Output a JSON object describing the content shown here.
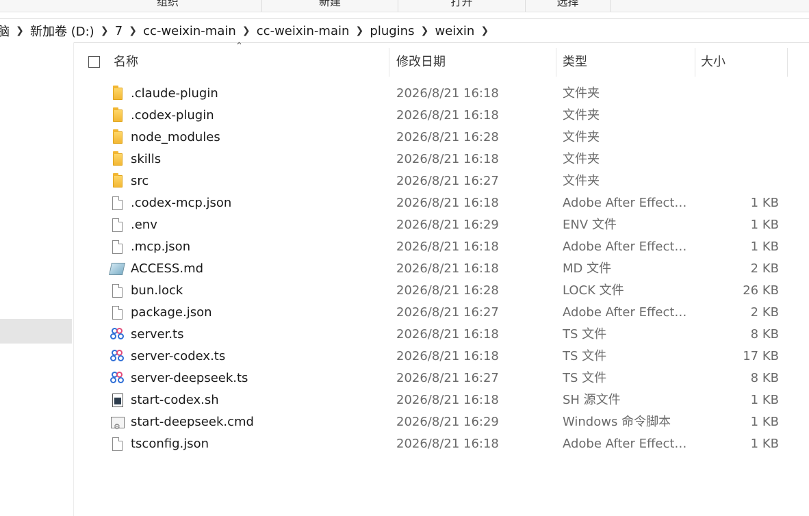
{
  "ribbon": {
    "groups": [
      "组织",
      "新建",
      "打开",
      "选择"
    ]
  },
  "address": {
    "crumbs": [
      "脑",
      "新加卷 (D:)",
      "7",
      "cc-weixin-main",
      "cc-weixin-main",
      "plugins",
      "weixin"
    ]
  },
  "columns": {
    "name": "名称",
    "date": "修改日期",
    "type": "类型",
    "size": "大小"
  },
  "files": [
    {
      "name": ".claude-plugin",
      "date": "2026/8/21 16:18",
      "type": "文件夹",
      "size": "",
      "icon": "folder-icon"
    },
    {
      "name": ".codex-plugin",
      "date": "2026/8/21 16:18",
      "type": "文件夹",
      "size": "",
      "icon": "folder-icon"
    },
    {
      "name": "node_modules",
      "date": "2026/8/21 16:28",
      "type": "文件夹",
      "size": "",
      "icon": "folder-icon"
    },
    {
      "name": "skills",
      "date": "2026/8/21 16:18",
      "type": "文件夹",
      "size": "",
      "icon": "folder-icon"
    },
    {
      "name": "src",
      "date": "2026/8/21 16:27",
      "type": "文件夹",
      "size": "",
      "icon": "folder-icon"
    },
    {
      "name": ".codex-mcp.json",
      "date": "2026/8/21 16:18",
      "type": "Adobe After Effects...",
      "size": "1 KB",
      "icon": "file-icon"
    },
    {
      "name": ".env",
      "date": "2026/8/21 16:29",
      "type": "ENV 文件",
      "size": "1 KB",
      "icon": "file-icon"
    },
    {
      "name": ".mcp.json",
      "date": "2026/8/21 16:18",
      "type": "Adobe After Effects...",
      "size": "1 KB",
      "icon": "file-icon"
    },
    {
      "name": "ACCESS.md",
      "date": "2026/8/21 16:18",
      "type": "MD 文件",
      "size": "2 KB",
      "icon": "markdown-file-icon"
    },
    {
      "name": "bun.lock",
      "date": "2026/8/21 16:28",
      "type": "LOCK 文件",
      "size": "26 KB",
      "icon": "file-icon"
    },
    {
      "name": "package.json",
      "date": "2026/8/21 16:27",
      "type": "Adobe After Effects...",
      "size": "2 KB",
      "icon": "file-icon"
    },
    {
      "name": "server.ts",
      "date": "2026/8/21 16:18",
      "type": "TS 文件",
      "size": "8 KB",
      "icon": "typescript-file-icon"
    },
    {
      "name": "server-codex.ts",
      "date": "2026/8/21 16:18",
      "type": "TS 文件",
      "size": "17 KB",
      "icon": "typescript-file-icon"
    },
    {
      "name": "server-deepseek.ts",
      "date": "2026/8/21 16:27",
      "type": "TS 文件",
      "size": "8 KB",
      "icon": "typescript-file-icon"
    },
    {
      "name": "start-codex.sh",
      "date": "2026/8/21 16:18",
      "type": "SH 源文件",
      "size": "1 KB",
      "icon": "shell-script-icon"
    },
    {
      "name": "start-deepseek.cmd",
      "date": "2026/8/21 16:29",
      "type": "Windows 命令脚本",
      "size": "1 KB",
      "icon": "cmd-script-icon"
    },
    {
      "name": "tsconfig.json",
      "date": "2026/8/21 16:18",
      "type": "Adobe After Effects...",
      "size": "1 KB",
      "icon": "file-icon"
    }
  ]
}
